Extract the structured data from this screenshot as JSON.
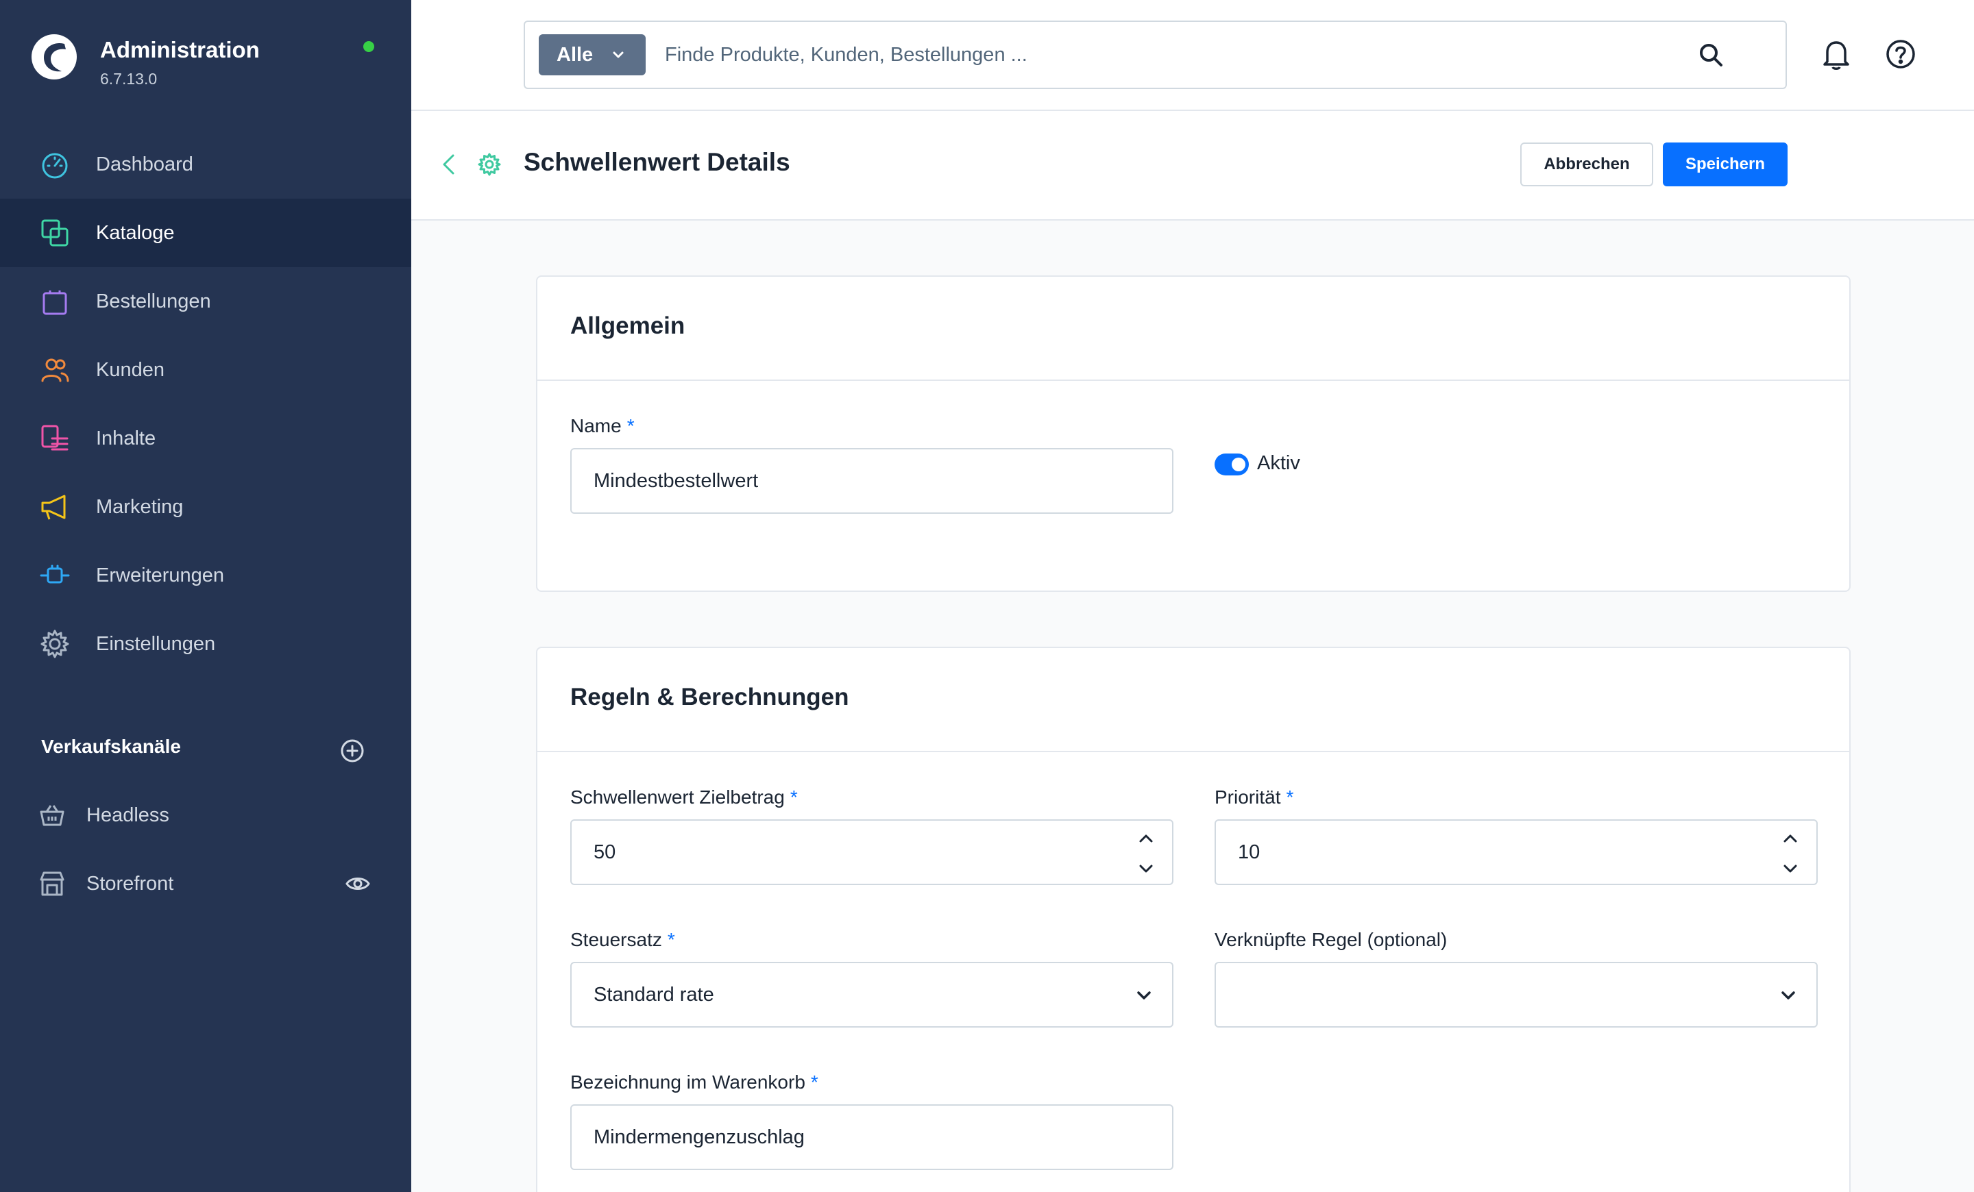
{
  "brand": {
    "title": "Administration",
    "version": "6.7.13.0"
  },
  "nav": [
    {
      "label": "Dashboard",
      "icon": "dashboard-icon",
      "active": false
    },
    {
      "label": "Kataloge",
      "icon": "catalog-icon",
      "active": true
    },
    {
      "label": "Bestellungen",
      "icon": "shopping-bag-icon",
      "active": false
    },
    {
      "label": "Kunden",
      "icon": "users-icon",
      "active": false
    },
    {
      "label": "Inhalte",
      "icon": "content-icon",
      "active": false
    },
    {
      "label": "Marketing",
      "icon": "megaphone-icon",
      "active": false
    },
    {
      "label": "Erweiterungen",
      "icon": "plug-icon",
      "active": false
    },
    {
      "label": "Einstellungen",
      "icon": "gear-icon",
      "active": false
    }
  ],
  "sales_channels": {
    "title": "Verkaufskanäle",
    "items": [
      {
        "label": "Headless",
        "icon": "basket-icon"
      },
      {
        "label": "Storefront",
        "icon": "storefront-icon"
      }
    ]
  },
  "search": {
    "type_label": "Alle",
    "placeholder": "Finde Produkte, Kunden, Bestellungen ..."
  },
  "page": {
    "title": "Schwellenwert Details",
    "cancel_label": "Abbrechen",
    "save_label": "Speichern"
  },
  "general": {
    "title": "Allgemein",
    "name_label": "Name",
    "required_mark": "*",
    "name_value": "Mindestbestellwert",
    "active_label": "Aktiv",
    "active": true
  },
  "rules": {
    "title": "Regeln & Berechnungen",
    "threshold_label": "Schwellenwert Zielbetrag",
    "threshold_value": "50",
    "priority_label": "Priorität",
    "priority_value": "10",
    "tax_label": "Steuersatz",
    "tax_value": "Standard rate",
    "rule_label": "Verknüpfte Regel (optional)",
    "rule_value": "",
    "cart_label": "Bezeichnung im Warenkorb",
    "cart_value": "Mindermengenzuschlag"
  },
  "colors": {
    "sidebar": "#253452",
    "sidebar_active": "#1b2a47",
    "primary": "#0870ff",
    "online": "#37d046"
  }
}
